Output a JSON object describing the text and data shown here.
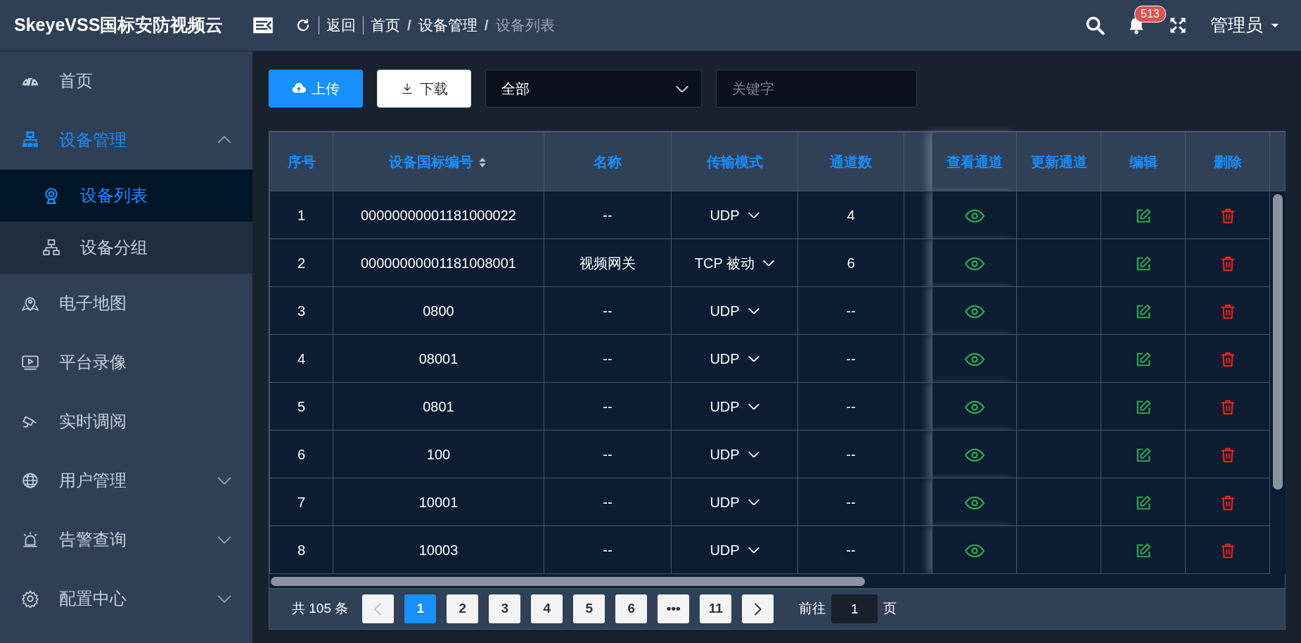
{
  "header": {
    "logo": "SkeyeVSS国标安防视频云",
    "back": "返回",
    "breadcrumb": [
      {
        "label": "首页",
        "current": false
      },
      {
        "separator": "/",
        "label": "设备管理",
        "current": false
      },
      {
        "separator": "/",
        "label": "设备列表",
        "current": true
      }
    ],
    "notification_count": "513",
    "user": "管理员"
  },
  "sidebar": {
    "items": [
      {
        "label": "首页",
        "kind": "link",
        "selected": false
      },
      {
        "label": "设备管理",
        "kind": "group",
        "selected": true,
        "expanded": true,
        "children": [
          {
            "label": "设备列表",
            "selected": true
          },
          {
            "label": "设备分组",
            "selected": false
          }
        ]
      },
      {
        "label": "电子地图",
        "kind": "link",
        "selected": false
      },
      {
        "label": "平台录像",
        "kind": "link",
        "selected": false
      },
      {
        "label": "实时调阅",
        "kind": "link",
        "selected": false
      },
      {
        "label": "用户管理",
        "kind": "group",
        "selected": false,
        "expanded": false
      },
      {
        "label": "告警查询",
        "kind": "group",
        "selected": false,
        "expanded": false
      },
      {
        "label": "配置中心",
        "kind": "group",
        "selected": false,
        "expanded": false
      }
    ]
  },
  "toolbar": {
    "upload": "上传",
    "download": "下载",
    "filter": {
      "value": "全部"
    },
    "search": {
      "placeholder": "关键字"
    }
  },
  "table": {
    "columns": [
      "序号",
      "设备国标编号",
      "名称",
      "传输模式",
      "通道数",
      "",
      "查看通道",
      "更新通道",
      "编辑",
      "删除"
    ],
    "rows": [
      {
        "index": "1",
        "device_id": "00000000001181000022",
        "name": "--",
        "transport": "UDP",
        "channels": "4"
      },
      {
        "index": "2",
        "device_id": "00000000001181008001",
        "name": "视频网关",
        "transport": "TCP 被动",
        "channels": "6"
      },
      {
        "index": "3",
        "device_id": "0800",
        "name": "--",
        "transport": "UDP",
        "channels": "--"
      },
      {
        "index": "4",
        "device_id": "08001",
        "name": "--",
        "transport": "UDP",
        "channels": "--"
      },
      {
        "index": "5",
        "device_id": "0801",
        "name": "--",
        "transport": "UDP",
        "channels": "--"
      },
      {
        "index": "6",
        "device_id": "100",
        "name": "--",
        "transport": "UDP",
        "channels": "--"
      },
      {
        "index": "7",
        "device_id": "10001",
        "name": "--",
        "transport": "UDP",
        "channels": "--"
      },
      {
        "index": "8",
        "device_id": "10003",
        "name": "--",
        "transport": "UDP",
        "channels": "--"
      }
    ]
  },
  "pagination": {
    "total": "共 105 条",
    "prev_disabled": true,
    "next_disabled": false,
    "pages": [
      {
        "label": "1",
        "selected": true
      },
      {
        "label": "2",
        "selected": false
      },
      {
        "label": "3",
        "selected": false
      },
      {
        "label": "4",
        "selected": false
      },
      {
        "label": "5",
        "selected": false
      },
      {
        "label": "6",
        "selected": false
      },
      {
        "label": "•••",
        "selected": false
      },
      {
        "label": "11",
        "selected": false
      }
    ],
    "goto_label": "前往",
    "goto_value": "1",
    "goto_suffix": "页"
  }
}
